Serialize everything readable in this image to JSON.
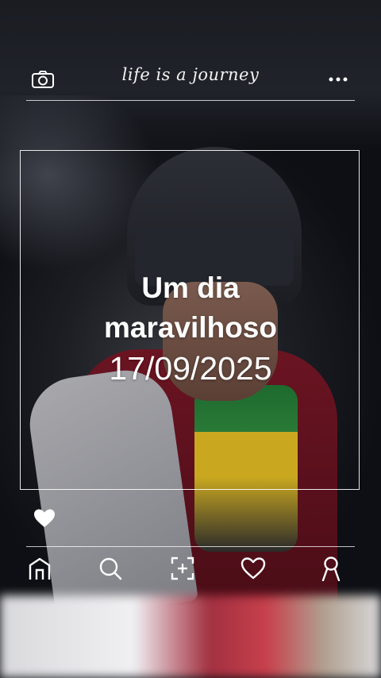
{
  "header": {
    "title": "life is a journey",
    "camera_icon": "camera-icon",
    "more_icon": "more-dots-icon"
  },
  "caption": {
    "line1": "Um dia",
    "line2": "maravilhoso",
    "date": "17/09/2025"
  },
  "like_icon": "heart-filled-icon",
  "bottom_nav": {
    "items": [
      {
        "name": "home",
        "icon": "home-icon"
      },
      {
        "name": "search",
        "icon": "search-icon"
      },
      {
        "name": "add",
        "icon": "add-post-icon"
      },
      {
        "name": "activity",
        "icon": "heart-outline-icon"
      },
      {
        "name": "profile",
        "icon": "profile-icon"
      }
    ]
  },
  "colors": {
    "overlay_line": "#ffffff",
    "text": "#ffffff"
  }
}
